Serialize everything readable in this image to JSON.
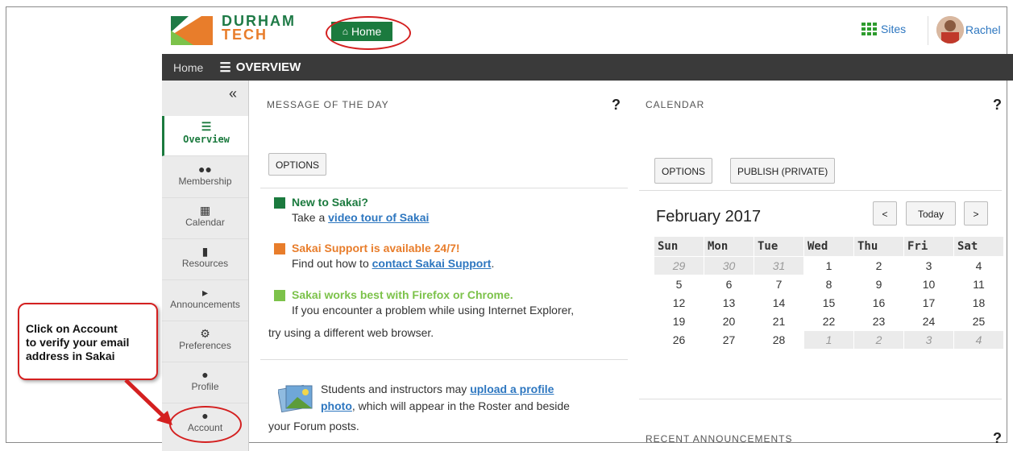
{
  "header": {
    "logo_line1": "DURHAM",
    "logo_line2": "TECH",
    "home_label": "Home",
    "sites_label": "Sites",
    "user_name": "Rachel"
  },
  "topnav": {
    "home": "Home",
    "section": "OVERVIEW"
  },
  "tools": [
    {
      "label": "Overview",
      "icon": "list-icon"
    },
    {
      "label": "Membership",
      "icon": "users-icon"
    },
    {
      "label": "Calendar",
      "icon": "calendar-icon"
    },
    {
      "label": "Resources",
      "icon": "folder-icon"
    },
    {
      "label": "Announcements",
      "icon": "megaphone-icon"
    },
    {
      "label": "Preferences",
      "icon": "gear-icon"
    },
    {
      "label": "Profile",
      "icon": "person-icon"
    },
    {
      "label": "Account",
      "icon": "person-icon"
    }
  ],
  "motd": {
    "title": "MESSAGE OF THE DAY",
    "options": "OPTIONS",
    "items": [
      {
        "title": "New to Sakai?",
        "pre": "Take a ",
        "link": "video tour of Sakai",
        "post": "",
        "color": "#1b7a3e"
      },
      {
        "title": "Sakai Support is available 24/7!",
        "pre": "Find out how to ",
        "link": "contact Sakai Support",
        "post": ".",
        "color": "#e87d2b"
      },
      {
        "title": "Sakai works best with Firefox or Chrome.",
        "line1": "If you encounter a problem while using Internet Explorer,",
        "line2": "try using a different web browser.",
        "color": "#7cc24a"
      }
    ],
    "photo_pre": "Students and instructors may ",
    "photo_link1": "upload a profile",
    "photo_link2": "photo",
    "photo_post": ", which will appear in the Roster and beside",
    "photo_post2": "your Forum posts."
  },
  "calendar": {
    "title": "CALENDAR",
    "options": "OPTIONS",
    "publish": "PUBLISH (PRIVATE)",
    "month": "February 2017",
    "prev": "<",
    "today": "Today",
    "next": ">",
    "days": [
      "Sun",
      "Mon",
      "Tue",
      "Wed",
      "Thu",
      "Fri",
      "Sat"
    ],
    "weeks": [
      [
        "29",
        "30",
        "31",
        "1",
        "2",
        "3",
        "4"
      ],
      [
        "5",
        "6",
        "7",
        "8",
        "9",
        "10",
        "11"
      ],
      [
        "12",
        "13",
        "14",
        "15",
        "16",
        "17",
        "18"
      ],
      [
        "19",
        "20",
        "21",
        "22",
        "23",
        "24",
        "25"
      ],
      [
        "26",
        "27",
        "28",
        "1",
        "2",
        "3",
        "4"
      ]
    ]
  },
  "announcements": {
    "title": "RECENT ANNOUNCEMENTS"
  },
  "callout": {
    "line1": "Click on  Account",
    "line2": "to verify your email",
    "line3": "address in Sakai"
  },
  "help": "?"
}
